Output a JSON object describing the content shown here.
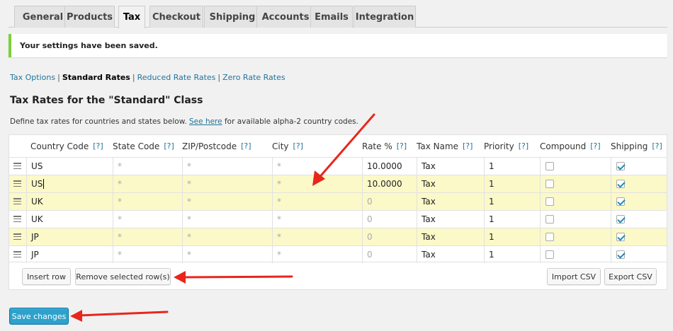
{
  "tabs": [
    "General",
    "Products",
    "Tax",
    "Checkout",
    "Shipping",
    "Accounts",
    "Emails",
    "Integration"
  ],
  "active_tab": "Tax",
  "notice": "Your settings have been saved.",
  "subnav": {
    "tax_options": "Tax Options",
    "standard": "Standard Rates",
    "reduced": "Reduced Rate Rates",
    "zero": "Zero Rate Rates",
    "separator": "|"
  },
  "heading": "Tax Rates for the \"Standard\" Class",
  "description": {
    "before": "Define tax rates for countries and states below. ",
    "link": "See here",
    "after": " for available alpha-2 country codes."
  },
  "columns": {
    "country": "Country Code",
    "state": "State Code",
    "zip": "ZIP/Postcode",
    "city": "City",
    "rate": "Rate %",
    "name": "Tax Name",
    "priority": "Priority",
    "compound": "Compound",
    "shipping": "Shipping",
    "help": "[?]"
  },
  "rows": [
    {
      "country": "US",
      "state": "*",
      "zip": "*",
      "city": "*",
      "rate": "10.0000",
      "rate_placeholder": false,
      "name": "Tax",
      "priority": "1",
      "compound": false,
      "shipping": true,
      "highlight": false
    },
    {
      "country": "US",
      "state": "*",
      "zip": "*",
      "city": "*",
      "rate": "10.0000",
      "rate_placeholder": false,
      "name": "Tax",
      "priority": "1",
      "compound": false,
      "shipping": true,
      "highlight": true
    },
    {
      "country": "UK",
      "state": "*",
      "zip": "*",
      "city": "*",
      "rate": "0",
      "rate_placeholder": true,
      "name": "Tax",
      "priority": "1",
      "compound": false,
      "shipping": true,
      "highlight": true
    },
    {
      "country": "UK",
      "state": "*",
      "zip": "*",
      "city": "*",
      "rate": "0",
      "rate_placeholder": true,
      "name": "Tax",
      "priority": "1",
      "compound": false,
      "shipping": true,
      "highlight": false
    },
    {
      "country": "JP",
      "state": "*",
      "zip": "*",
      "city": "*",
      "rate": "0",
      "rate_placeholder": true,
      "name": "Tax",
      "priority": "1",
      "compound": false,
      "shipping": true,
      "highlight": true
    },
    {
      "country": "JP",
      "state": "*",
      "zip": "*",
      "city": "*",
      "rate": "0",
      "rate_placeholder": true,
      "name": "Tax",
      "priority": "1",
      "compound": false,
      "shipping": true,
      "highlight": false
    }
  ],
  "buttons": {
    "insert": "Insert row",
    "remove": "Remove selected row(s)",
    "import": "Import CSV",
    "export": "Export CSV",
    "save": "Save changes"
  },
  "colors": {
    "highlight_row": "#fbf9c8",
    "link": "#21759b",
    "notice_border": "#7ad03a",
    "primary_button": "#2ea2cc",
    "annotation_arrow": "#e8261c"
  }
}
